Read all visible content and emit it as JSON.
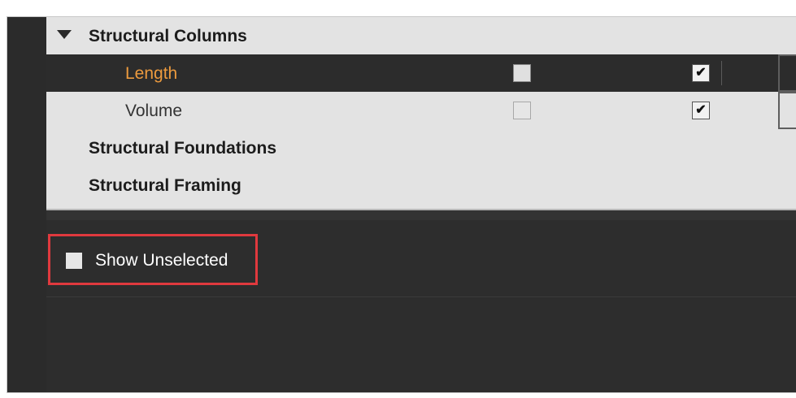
{
  "tree": {
    "rows": [
      {
        "label": "Structural Columns",
        "type": "category",
        "expanded": true
      },
      {
        "label": "Length",
        "type": "parameter",
        "selected": true,
        "checkbox_1": false,
        "checkbox_2": true
      },
      {
        "label": "Volume",
        "type": "parameter",
        "selected": false,
        "checkbox_1": false,
        "checkbox_2": true
      },
      {
        "label": "Structural Foundations",
        "type": "category"
      },
      {
        "label": "Structural Framing",
        "type": "category"
      }
    ]
  },
  "options": {
    "show_unselected_label": "Show Unselected",
    "show_unselected_checked": false
  },
  "colors": {
    "selected_text": "#ec9a3e",
    "highlight_border": "#e0393e",
    "panel_background": "#2d2d2d",
    "tree_background": "#e3e3e3"
  }
}
